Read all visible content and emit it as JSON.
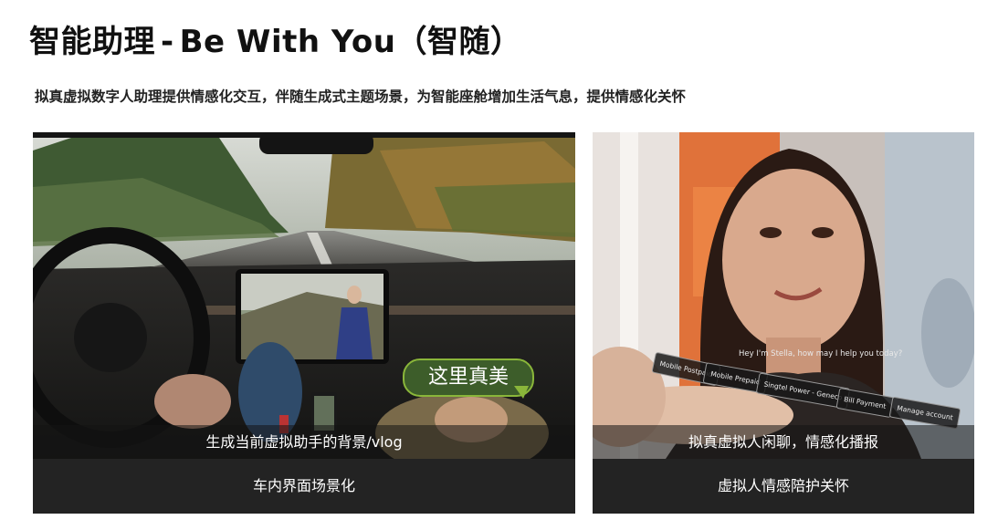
{
  "header": {
    "title_cn": "智能助理",
    "title_sep": "-",
    "title_en": "Be With You",
    "title_paren": "（智随）",
    "subtitle": "拟真虚拟数字人助理提供情感化交互，伴随生成式主题场景，为智能座舱增加生活气息，提供情感化关怀"
  },
  "left_card": {
    "speech_bubble": "这里真美",
    "overlay_caption": "生成当前虚拟助手的背景/vlog",
    "caption": "车内界面场景化"
  },
  "right_card": {
    "greeting": "Hey I'm Stella, how may I help you today?",
    "chips": [
      "Mobile Postpaid",
      "Mobile Prepaid",
      "Singtel Power - Geneco",
      "Bill Payment",
      "Manage account"
    ],
    "overlay_caption": "拟真虚拟人闲聊，情感化播报",
    "caption": "虚拟人情感陪护关怀"
  }
}
